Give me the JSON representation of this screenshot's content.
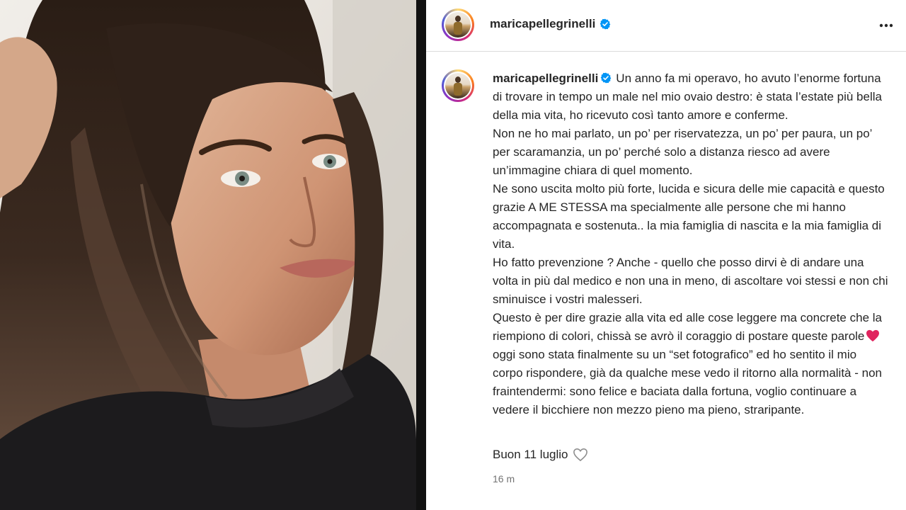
{
  "post": {
    "username": "maricapellegrinelli",
    "verified": true,
    "more_icon": "more-horizontal-icon"
  },
  "caption": {
    "username": "maricapellegrinelli",
    "text_part1": "Un anno fa mi operavo, ho avuto l’enorme fortuna di trovare in tempo un male nel mio ovaio destro: è stata l’estate più bella della mia vita, ho ricevuto così tanto amore e conferme.\nNon ne ho mai parlato, un po’ per riservatezza, un po’ per paura, un po’ per scaramanzia, un po’ perché solo a distanza riesco ad avere un’immagine chiara di quel momento.\nNe sono uscita molto più forte, lucida e sicura delle mie capacità e questo grazie A ME STESSA ma specialmente alle persone che mi hanno accompagnata e sostenuta.. la mia famiglia di nascita e la mia famiglia di vita.\nHo fatto prevenzione ? Anche - quello che posso dirvi è di andare una volta in più dal medico e non una in meno, di ascoltare voi stessi e non chi sminuisce i vostri malesseri.\nQuesto è per dire grazie alla vita ed alle cose leggere ma concrete che la riempiono di colori, chissà se avrò il coraggio di postare queste parole",
    "emoji": "red-heart-emoji",
    "text_part2": " oggi sono stata finalmente su un “set fotografico” ed ho sentito il mio corpo rispondere, già da qualche mese vedo il ritorno alla normalità - non fraintendermi: sono felice e baciata dalla fortuna, voglio continuare a vedere il bicchiere non mezzo pieno ma pieno, straripante.",
    "closing": "Buon 11 luglio",
    "like_icon": "heart-outline-icon",
    "timestamp": "16 m"
  },
  "colors": {
    "text": "#262626",
    "verified_blue": "#0095f6",
    "timestamp_gray": "#737373",
    "heart_red": "#e0245e"
  }
}
